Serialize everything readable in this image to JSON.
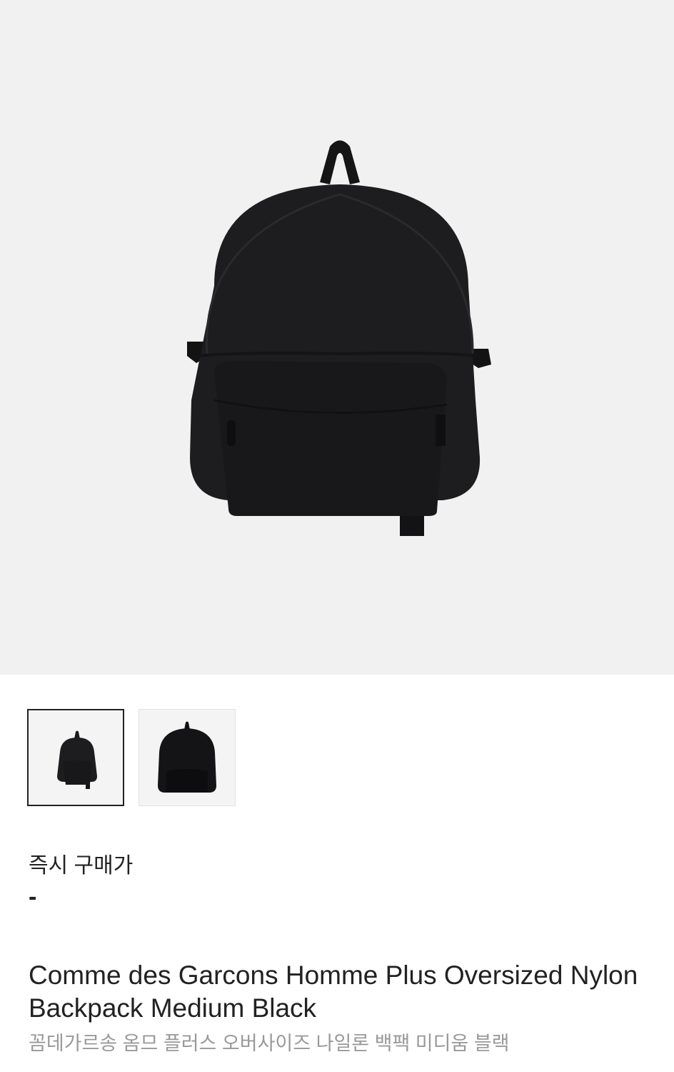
{
  "product": {
    "main_image": {
      "icon": "backpack-image",
      "background": "#f1f1f1"
    },
    "thumbnails": [
      {
        "icon": "backpack-image",
        "selected": true
      },
      {
        "icon": "backpack-image",
        "selected": false
      }
    ],
    "price_label": "즉시 구매가",
    "price_value": "-",
    "name_en": "Comme des Garcons Homme Plus Oversized Nylon Backpack Medium Black",
    "name_ko": "꼼데가르송 옴므 플러스 오버사이즈 나일론 백팩 미디움 블랙"
  }
}
